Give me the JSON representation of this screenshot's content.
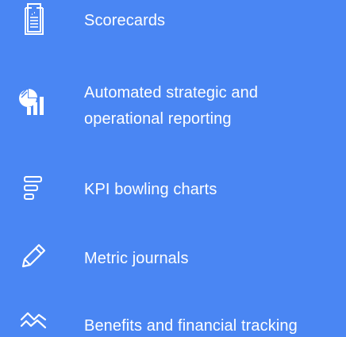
{
  "colors": {
    "background": "#4a86f3",
    "foreground": "#ffffff"
  },
  "features": [
    {
      "icon": "scorecard-document-icon",
      "label": "Scorecards"
    },
    {
      "icon": "pie-bar-chart-icon",
      "label_line1": "Automated strategic and",
      "label_line2": "operational reporting"
    },
    {
      "icon": "bowling-chart-icon",
      "label": "KPI bowling charts"
    },
    {
      "icon": "pencil-icon",
      "label": "Metric journals"
    },
    {
      "icon": "trend-lines-icon",
      "label": "Benefits and financial tracking"
    }
  ]
}
